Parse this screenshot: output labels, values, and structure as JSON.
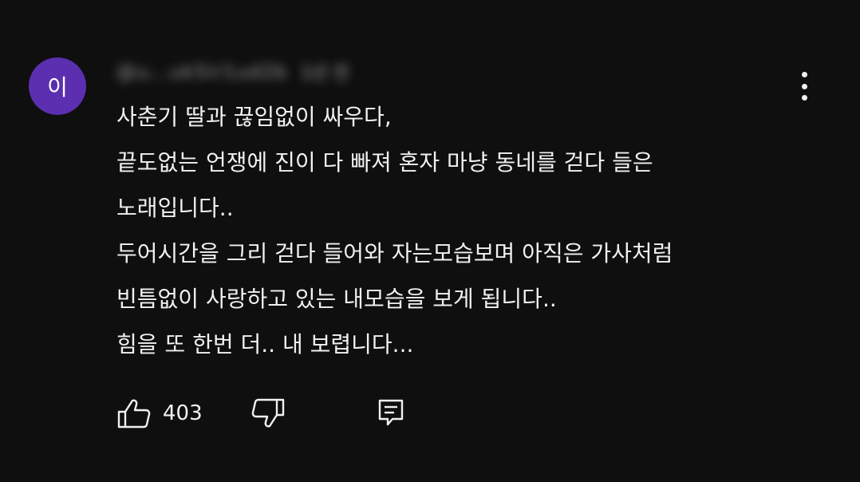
{
  "comment": {
    "avatar_initial": "이",
    "avatar_color": "#5b2fb0",
    "author_handle": "@u...uk5ir1ud2b",
    "timestamp": "1년 전",
    "lines": [
      "사춘기 딸과 끊임없이 싸우다,",
      "끝도없는 언쟁에 진이 다 빠져 혼자 마냥 동네를 걷다 들은",
      "노래입니다..",
      "두어시간을 그리 걷다 들어와 자는모습보며 아직은 가사처럼",
      "빈틈없이 사랑하고 있는 내모습을 보게 됩니다..",
      "힘을 또 한번 더..  내 보렵니다..."
    ],
    "like_count": "403",
    "icons": {
      "like": "thumbs-up-icon",
      "dislike": "thumbs-down-icon",
      "reply": "reply-comment-icon",
      "menu": "more-vertical-icon"
    }
  }
}
